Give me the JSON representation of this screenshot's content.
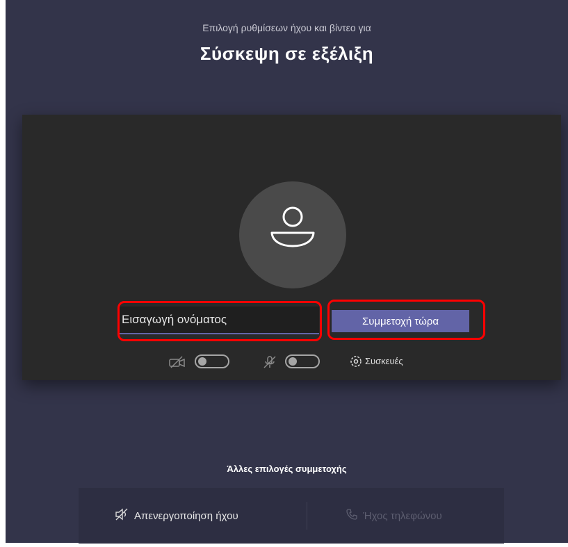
{
  "header": {
    "subtitle": "Επιλογή ρυθμίσεων ήχου και βίντεο για",
    "title": "Σύσκεψη σε εξέλιξη"
  },
  "preview": {
    "avatar_icon": "person-icon",
    "name_input": {
      "placeholder": "Εισαγωγή ονόματος",
      "value": ""
    },
    "join_button_label": "Συμμετοχή τώρα",
    "highlight_color": "#ff0000"
  },
  "controls": {
    "video": {
      "icon": "camera-off-icon",
      "toggle_on": false
    },
    "mic": {
      "icon": "mic-off-icon",
      "toggle_on": false
    },
    "devices": {
      "icon": "gear-icon",
      "label": "Συσκευές"
    }
  },
  "other_options": {
    "title": "Άλλες επιλογές συμμετοχής",
    "mute_audio_label": "Απενεργοποίηση ήχου",
    "phone_audio_label": "Ήχος τηλεφώνου"
  },
  "colors": {
    "background": "#33344a",
    "preview_background": "#292929",
    "accent": "#6264a7"
  }
}
